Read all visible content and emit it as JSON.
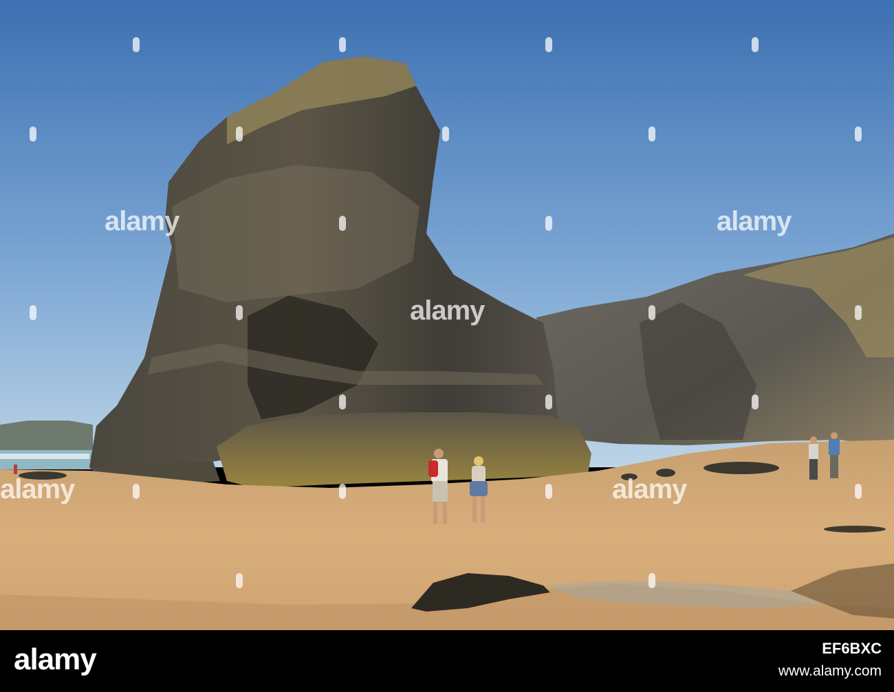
{
  "photo": {
    "scene": "beach-sea-stack"
  },
  "watermark": {
    "text": "alamy"
  },
  "footer": {
    "logo": "alamy",
    "image_id": "EF6BXC",
    "url": "www.alamy.com"
  },
  "colors": {
    "sky_top": "#3f72b4",
    "sky_bottom": "#b9d3e6",
    "sand": "#d5ab78",
    "rock_dark": "#3c3a33",
    "rock_light": "#8a7b5c",
    "footer_bg": "#000000"
  }
}
